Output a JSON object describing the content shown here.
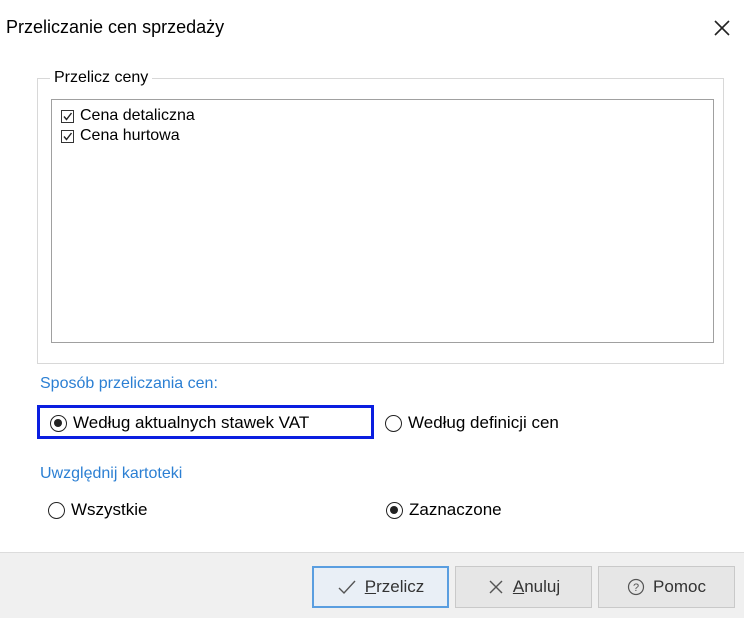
{
  "dialog": {
    "title": "Przeliczanie cen sprzedaży"
  },
  "group": {
    "legend": "Przelicz ceny",
    "items": [
      {
        "label": "Cena detaliczna",
        "checked": true
      },
      {
        "label": "Cena hurtowa",
        "checked": true
      }
    ]
  },
  "method": {
    "label": "Sposób przeliczania cen:",
    "options": [
      {
        "label": "Według aktualnych stawek VAT",
        "selected": true
      },
      {
        "label": "Według definicji cen",
        "selected": false
      }
    ]
  },
  "records": {
    "label": "Uwzględnij kartoteki",
    "options": [
      {
        "label": "Wszystkie",
        "selected": false
      },
      {
        "label": "Zaznaczone",
        "selected": true
      }
    ]
  },
  "buttons": {
    "recalc": {
      "mnemonic": "P",
      "rest": "rzelicz"
    },
    "cancel": {
      "mnemonic": "A",
      "rest": "nuluj"
    },
    "help": {
      "label": "Pomoc"
    }
  },
  "colors": {
    "accent": "#2b7fd3",
    "focus": "#0a1ee0"
  }
}
